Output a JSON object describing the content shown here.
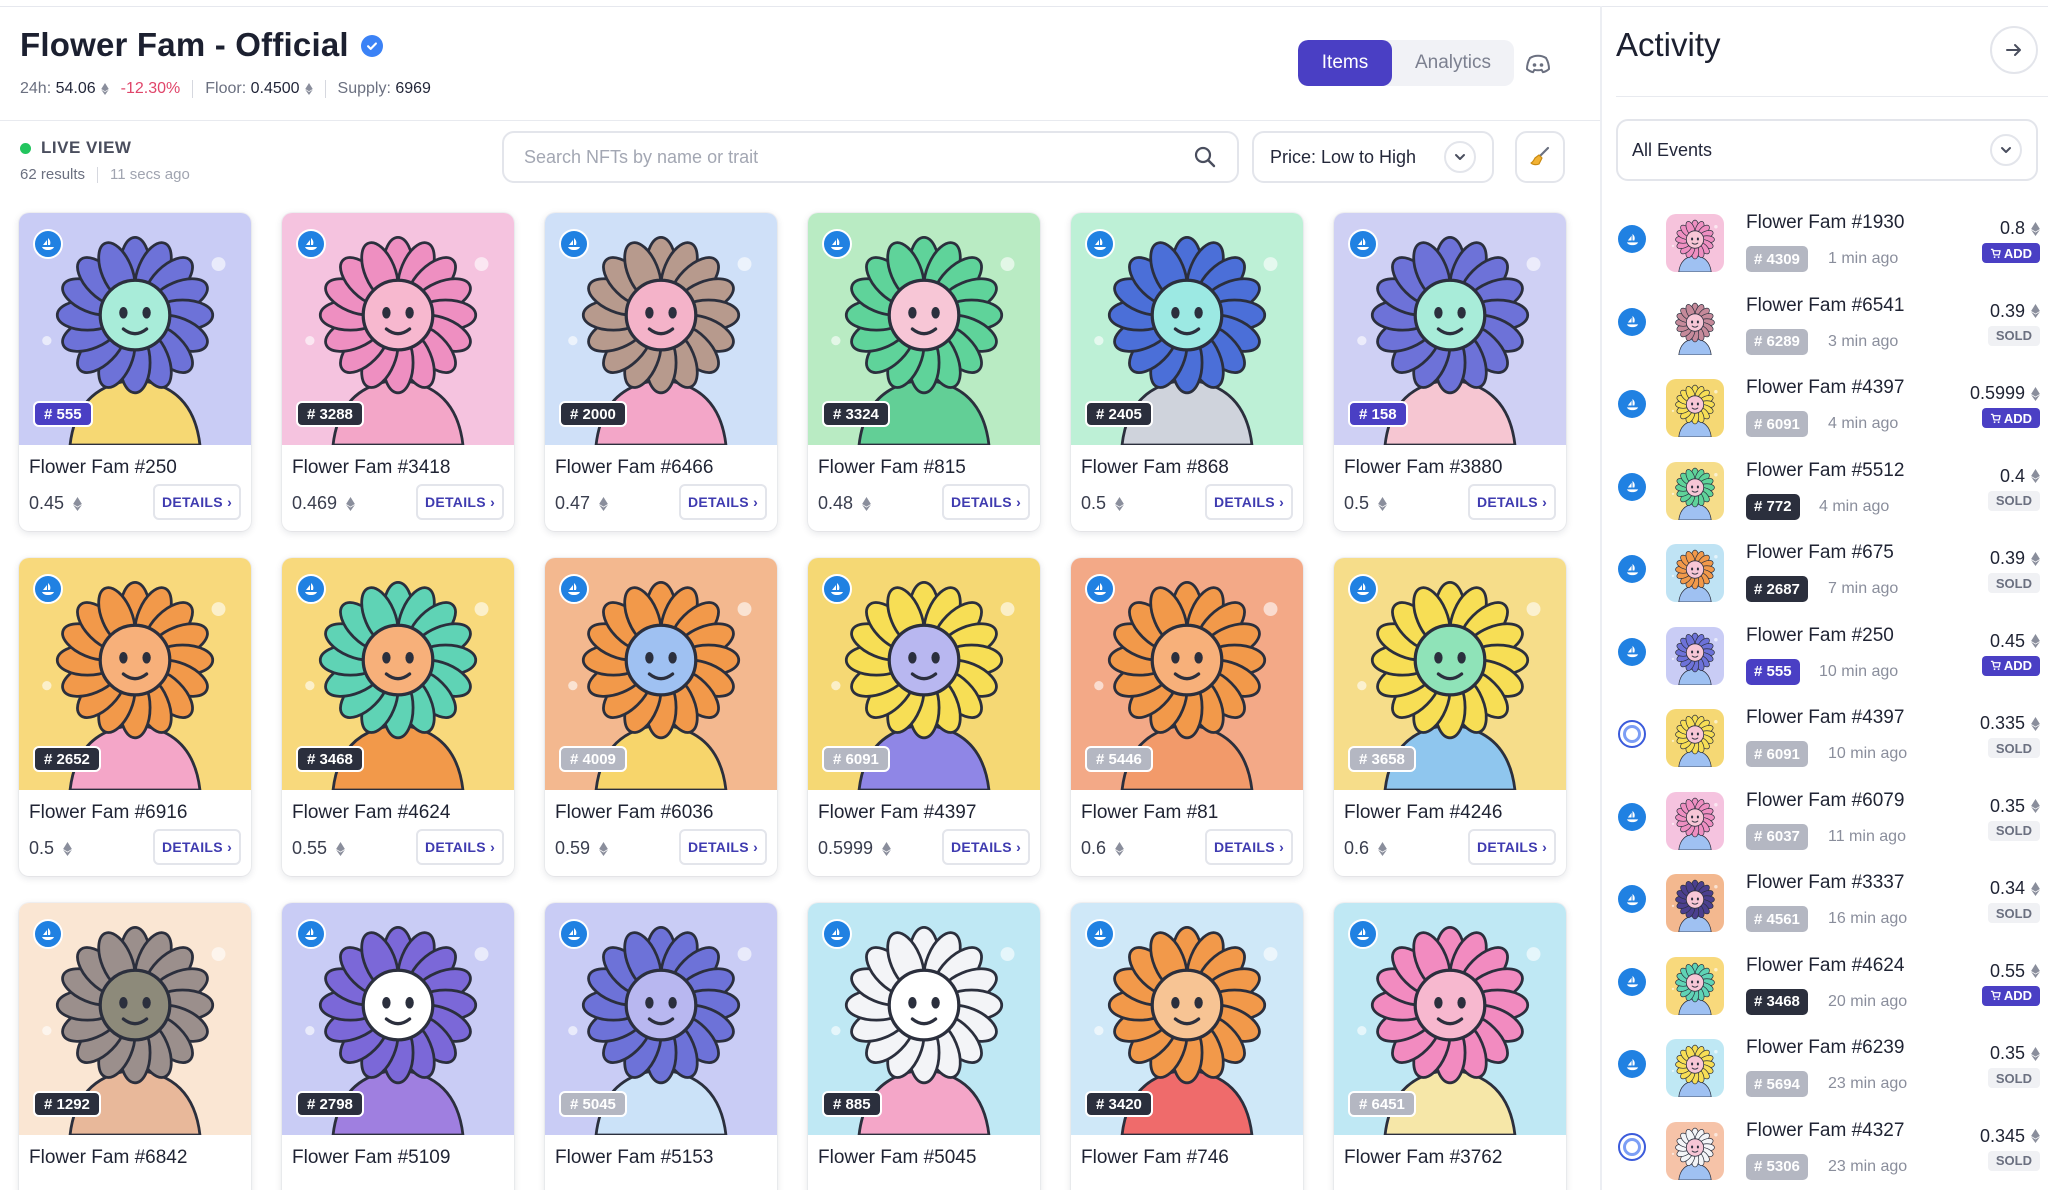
{
  "collection": {
    "title": "Flower Fam - Official",
    "stats": {
      "volume_label": "24h:",
      "volume_value": "54.06",
      "change": "-12.30%",
      "floor_label": "Floor:",
      "floor_value": "0.4500",
      "supply_label": "Supply:",
      "supply_value": "6969"
    }
  },
  "tabs": {
    "items": "Items",
    "analytics": "Analytics"
  },
  "live": {
    "label": "LIVE VIEW",
    "results": "62 results",
    "updated": "11 secs ago"
  },
  "search": {
    "placeholder": "Search NFTs by name or trait"
  },
  "sort": {
    "label": "Price: Low to High"
  },
  "details_label": "DETAILS ›",
  "colors": {
    "accent": "#4a3fc4",
    "opensea": "#2081e2",
    "negative": "#e0456a",
    "live": "#22c55e"
  },
  "grid": [
    {
      "rank": "# 555",
      "rank_color": "#4a3fc4",
      "name": "Flower Fam #250",
      "price": "0.45",
      "bg": "#c9ccf5",
      "petal": "#6d72d8",
      "face": "#a8ecd9",
      "body": "#f6d873"
    },
    {
      "rank": "# 3288",
      "rank_color": "#2b2f3d",
      "name": "Flower Fam #3418",
      "price": "0.469",
      "bg": "#f5c3df",
      "petal": "#ee8fc1",
      "face": "#f7b8cf",
      "body": "#f3a6c8"
    },
    {
      "rank": "# 2000",
      "rank_color": "#2b2f3d",
      "name": "Flower Fam #6466",
      "price": "0.47",
      "bg": "#cfe0f8",
      "petal": "#b79a8d",
      "face": "#f4b3c9",
      "body": "#f3a6c8"
    },
    {
      "rank": "# 3324",
      "rank_color": "#2b2f3d",
      "name": "Flower Fam #815",
      "price": "0.48",
      "bg": "#b9ebc3",
      "petal": "#5fd39a",
      "face": "#f7c6d6",
      "body": "#62cf96"
    },
    {
      "rank": "# 2405",
      "rank_color": "#2b2f3d",
      "name": "Flower Fam #868",
      "price": "0.5",
      "bg": "#bdf0d6",
      "petal": "#4b6fd8",
      "face": "#9ce9e3",
      "body": "#cfd3dc"
    },
    {
      "rank": "# 158",
      "rank_color": "#4a3fc4",
      "name": "Flower Fam #3880",
      "price": "0.5",
      "bg": "#cfd0f4",
      "petal": "#6d72d8",
      "face": "#a8ecd9",
      "body": "#f6c6d2"
    },
    {
      "rank": "# 2652",
      "rank_color": "#2b2f3d",
      "name": "Flower Fam #6916",
      "price": "0.5",
      "bg": "#f8d97c",
      "petal": "#f2994a",
      "face": "#f7b07a",
      "body": "#f4a6c8"
    },
    {
      "rank": "# 3468",
      "rank_color": "#2b2f3d",
      "name": "Flower Fam #4624",
      "price": "0.55",
      "bg": "#f8d97c",
      "petal": "#5fd3b5",
      "face": "#f7b07a",
      "body": "#f2994a"
    },
    {
      "rank": "# 4009",
      "rank_color": "#b4b7c2",
      "name": "Flower Fam #6036",
      "price": "0.59",
      "bg": "#f3b88f",
      "petal": "#f2994a",
      "face": "#9fc1f2",
      "body": "#f7d56b"
    },
    {
      "rank": "# 6091",
      "rank_color": "#b4b7c2",
      "name": "Flower Fam #4397",
      "price": "0.5999",
      "bg": "#f5d874",
      "petal": "#f7de55",
      "face": "#b8b7f0",
      "body": "#8f86e6"
    },
    {
      "rank": "# 5446",
      "rank_color": "#b4b7c2",
      "name": "Flower Fam #81",
      "price": "0.6",
      "bg": "#f3a987",
      "petal": "#f2994a",
      "face": "#f7b07a",
      "body": "#f29a6a"
    },
    {
      "rank": "# 3658",
      "rank_color": "#b4b7c2",
      "name": "Flower Fam #4246",
      "price": "0.6",
      "bg": "#f6dd8a",
      "petal": "#f7de55",
      "face": "#8fe3b8",
      "body": "#8fc6ee"
    },
    {
      "rank": "# 1292",
      "rank_color": "#2b2f3d",
      "name": "Flower Fam #6842",
      "price": "",
      "bg": "#fae6d3",
      "petal": "#9b8f8c",
      "face": "#8d8a7a",
      "body": "#e8b89a"
    },
    {
      "rank": "# 2798",
      "rank_color": "#2b2f3d",
      "name": "Flower Fam #5109",
      "price": "",
      "bg": "#c9ccf5",
      "petal": "#7b68d8",
      "face": "#ffffff",
      "body": "#9f7fe0"
    },
    {
      "rank": "# 5045",
      "rank_color": "#b4b7c2",
      "name": "Flower Fam #5153",
      "price": "",
      "bg": "#c9ccf5",
      "petal": "#6d72d8",
      "face": "#b8b7f0",
      "body": "#cbe2f8"
    },
    {
      "rank": "# 885",
      "rank_color": "#2b2f3d",
      "name": "Flower Fam #5045",
      "price": "",
      "bg": "#bfe8f4",
      "petal": "#f3f4f7",
      "face": "#ffffff",
      "body": "#f4a6c8"
    },
    {
      "rank": "# 3420",
      "rank_color": "#2b2f3d",
      "name": "Flower Fam #746",
      "price": "",
      "bg": "#cfe8f8",
      "petal": "#f2994a",
      "face": "#f7c494",
      "body": "#ef6b6b"
    },
    {
      "rank": "# 6451",
      "rank_color": "#b4b7c2",
      "name": "Flower Fam #3762",
      "price": "",
      "bg": "#bfe8f4",
      "petal": "#f28bc0",
      "face": "#f7b8cf",
      "body": "#f6e7a8"
    }
  ],
  "activity": {
    "title": "Activity",
    "filter": "All Events",
    "feed": [
      {
        "name": "Flower Fam #1930",
        "rank": "# 4309",
        "rank_color": "#b4b7c2",
        "time": "1 min ago",
        "price": "0.8",
        "badge": "ADD",
        "market": "opensea",
        "bg": "#f6c3dc",
        "petal": "#ee8fc1"
      },
      {
        "name": "Flower Fam #6541",
        "rank": "# 6289",
        "rank_color": "#b4b7c2",
        "time": "3 min ago",
        "price": "0.39",
        "badge": "SOLD",
        "market": "opensea",
        "bg": "#ffffff",
        "petal": "#c58a9a"
      },
      {
        "name": "Flower Fam #4397",
        "rank": "# 6091",
        "rank_color": "#b4b7c2",
        "time": "4 min ago",
        "price": "0.5999",
        "badge": "ADD",
        "market": "opensea",
        "bg": "#f5d874",
        "petal": "#f7de55"
      },
      {
        "name": "Flower Fam #5512",
        "rank": "# 772",
        "rank_color": "#2b2f3d",
        "time": "4 min ago",
        "price": "0.4",
        "badge": "SOLD",
        "market": "opensea",
        "bg": "#f6dd8a",
        "petal": "#5fd39a"
      },
      {
        "name": "Flower Fam #675",
        "rank": "# 2687",
        "rank_color": "#2b2f3d",
        "time": "7 min ago",
        "price": "0.39",
        "badge": "SOLD",
        "market": "opensea",
        "bg": "#bfe3f4",
        "petal": "#f2994a"
      },
      {
        "name": "Flower Fam #250",
        "rank": "# 555",
        "rank_color": "#4a3fc4",
        "time": "10 min ago",
        "price": "0.45",
        "badge": "ADD",
        "market": "opensea",
        "bg": "#c9ccf5",
        "petal": "#6d72d8"
      },
      {
        "name": "Flower Fam #4397",
        "rank": "# 6091",
        "rank_color": "#b4b7c2",
        "time": "10 min ago",
        "price": "0.335",
        "badge": "SOLD",
        "market": "looksrare",
        "bg": "#f5d874",
        "petal": "#f7de55"
      },
      {
        "name": "Flower Fam #6079",
        "rank": "# 6037",
        "rank_color": "#b4b7c2",
        "time": "11 min ago",
        "price": "0.35",
        "badge": "SOLD",
        "market": "opensea",
        "bg": "#f5c3df",
        "petal": "#ee8fc1"
      },
      {
        "name": "Flower Fam #3337",
        "rank": "# 4561",
        "rank_color": "#b4b7c2",
        "time": "16 min ago",
        "price": "0.34",
        "badge": "SOLD",
        "market": "opensea",
        "bg": "#f3b88f",
        "petal": "#4b3f8e"
      },
      {
        "name": "Flower Fam #4624",
        "rank": "# 3468",
        "rank_color": "#2b2f3d",
        "time": "20 min ago",
        "price": "0.55",
        "badge": "ADD",
        "market": "opensea",
        "bg": "#f8d97c",
        "petal": "#5fd3b5"
      },
      {
        "name": "Flower Fam #6239",
        "rank": "# 5694",
        "rank_color": "#b4b7c2",
        "time": "23 min ago",
        "price": "0.35",
        "badge": "SOLD",
        "market": "opensea",
        "bg": "#bfe8f4",
        "petal": "#f7de55"
      },
      {
        "name": "Flower Fam #4327",
        "rank": "# 5306",
        "rank_color": "#b4b7c2",
        "time": "23 min ago",
        "price": "0.345",
        "badge": "SOLD",
        "market": "looksrare",
        "bg": "#f6c3a8",
        "petal": "#f3f4f7"
      }
    ]
  }
}
